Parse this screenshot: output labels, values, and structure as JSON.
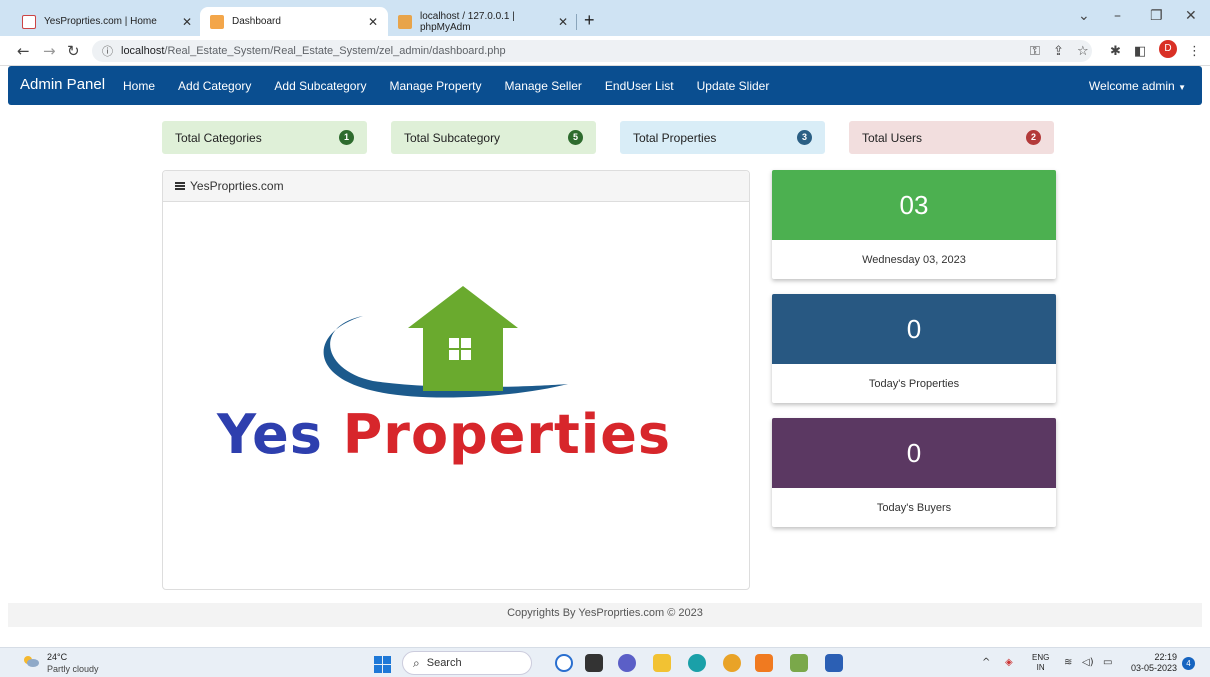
{
  "browser": {
    "tabs": [
      {
        "title": "YesProprties.com | Home"
      },
      {
        "title": "Dashboard"
      },
      {
        "title": "localhost / 127.0.0.1 | phpMyAdm"
      }
    ],
    "url_host": "localhost",
    "url_path": "/Real_Estate_System/Real_Estate_System/zel_admin/dashboard.php",
    "profile_initial": "D"
  },
  "navbar": {
    "brand": "Admin Panel",
    "links": [
      "Home",
      "Add Category",
      "Add Subcategory",
      "Manage Property",
      "Manage Seller",
      "EndUser List",
      "Update Slider"
    ],
    "welcome": "Welcome admin"
  },
  "stats": [
    {
      "label": "Total Categories",
      "count": "1",
      "bg": "#dff0d8",
      "badge": "#2e6b2e"
    },
    {
      "label": "Total Subcategory",
      "count": "5",
      "bg": "#dff0d8",
      "badge": "#2e6b2e"
    },
    {
      "label": "Total Properties",
      "count": "3",
      "bg": "#d9edf7",
      "badge": "#2b5f84"
    },
    {
      "label": "Total Users",
      "count": "2",
      "bg": "#f2dede",
      "badge": "#b33a3a"
    }
  ],
  "panel": {
    "heading": "YesProprties.com",
    "logo_word1": "Yes",
    "logo_word2": "Properties"
  },
  "cards": [
    {
      "value": "03",
      "label": "Wednesday 03, 2023",
      "color": "#4cb050"
    },
    {
      "value": "0",
      "label": "Today's Properties",
      "color": "#285882"
    },
    {
      "value": "0",
      "label": "Today's Buyers",
      "color": "#5b3862"
    }
  ],
  "footer": "Copyrights By YesProprties.com © 2023",
  "taskbar": {
    "temp": "24°C",
    "weather": "Partly cloudy",
    "search_label": "Search",
    "lang_top": "ENG",
    "lang_bottom": "IN",
    "time": "22:19",
    "date": "03-05-2023",
    "notifications": "4"
  }
}
